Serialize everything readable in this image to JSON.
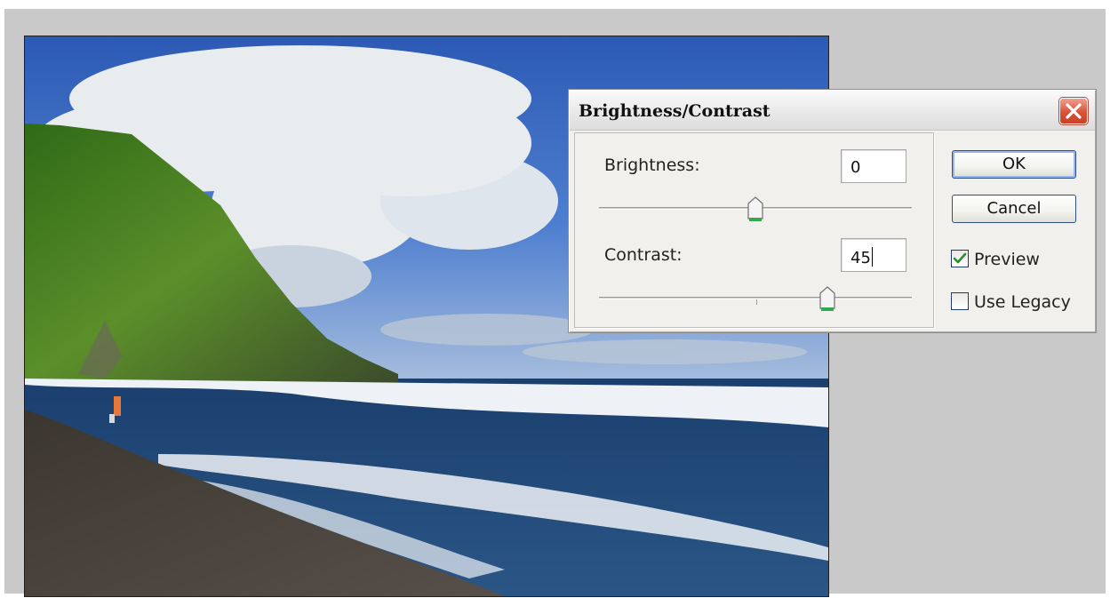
{
  "dialog": {
    "title": "Brightness/Contrast",
    "brightness": {
      "label": "Brightness:",
      "value": "0",
      "slider_fraction": 0.5
    },
    "contrast": {
      "label": "Contrast:",
      "value": "45",
      "slider_fraction": 0.725
    },
    "ok_label": "OK",
    "cancel_label": "Cancel",
    "preview": {
      "label": "Preview",
      "checked": true
    },
    "use_legacy": {
      "label": "Use Legacy",
      "checked": false
    }
  },
  "icons": {
    "close": "close-icon",
    "slider_thumb": "slider-thumb-icon",
    "checkmark": "checkmark-icon"
  },
  "colors": {
    "close_button": "#d9523a",
    "checkmark": "#2e8b2e",
    "button_border": "#2f4f86",
    "thumb_green": "#35a852"
  }
}
